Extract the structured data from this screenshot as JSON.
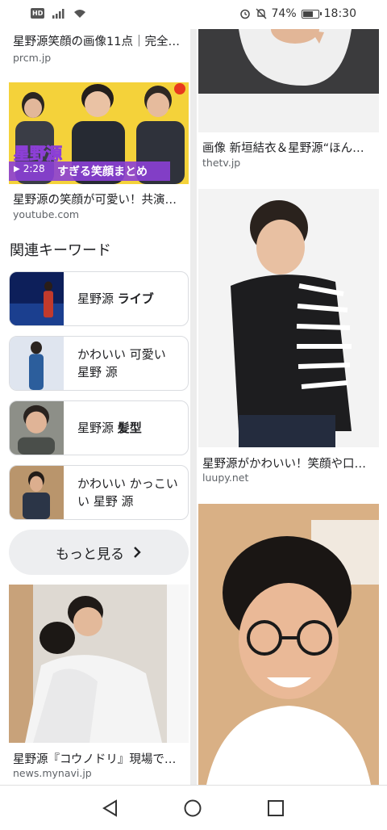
{
  "status_bar": {
    "hd_badge": "HD",
    "battery_percent": "74%",
    "battery_level": 0.74,
    "time": "18:30",
    "icons": [
      "signal-icon",
      "wifi-icon",
      "alarm-icon",
      "mute-icon",
      "battery-icon"
    ]
  },
  "results_left": [
    {
      "caption": "星野源笑顔の画像11点｜完全…",
      "domain": "prcm.jp"
    },
    {
      "caption": "星野源の笑顔が可愛い！共演…",
      "domain": "youtube.com",
      "overlay_title": "星野源",
      "overlay_subtitle": "すぎる笑顔まとめ",
      "duration": "2:28"
    },
    {
      "caption": "星野源『コウノドリ』現場で…",
      "domain": "news.mynavi.jp"
    }
  ],
  "results_right": [
    {
      "caption": "画像 新垣結衣＆星野源“ほん…",
      "domain": "thetv.jp"
    },
    {
      "caption": "星野源がかわいい！笑顔や口…",
      "domain": "luupy.net"
    }
  ],
  "related": {
    "title": "関連キーワード",
    "items": [
      {
        "prefix": "星野源 ",
        "bold": "ライブ"
      },
      {
        "prefix": "かわいい 可愛い 星野 源",
        "bold": ""
      },
      {
        "prefix": "星野源 ",
        "bold": "髪型"
      },
      {
        "prefix": "かわいい かっこいい 星野 源",
        "bold": ""
      }
    ],
    "more_label": "もっと見る"
  },
  "colors": {
    "accent_red": "#e8391e",
    "yellow_bg": "#f4d23a",
    "overlay_purple": "#8c3fd6"
  }
}
